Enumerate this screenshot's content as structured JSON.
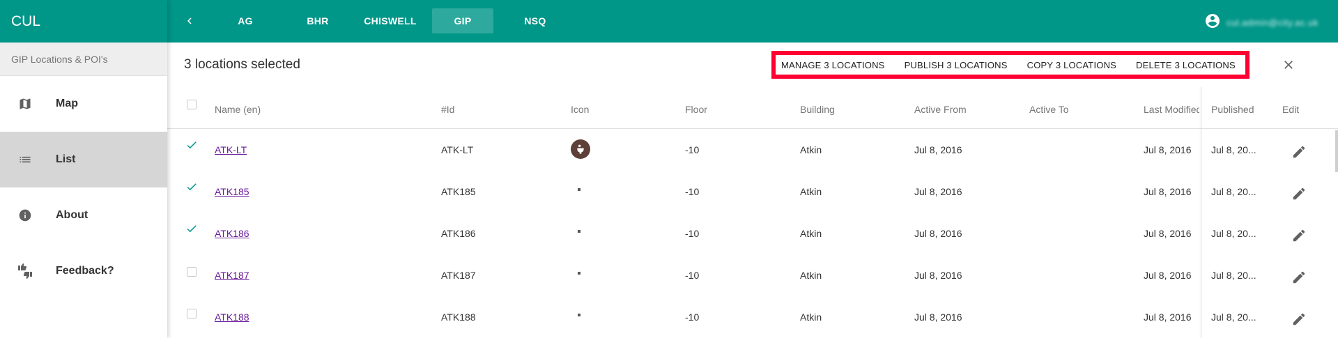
{
  "app": {
    "brand": "CUL"
  },
  "sidebar": {
    "subtitle": "GIP Locations & POI's",
    "items": [
      {
        "label": "Map",
        "icon": "map-icon"
      },
      {
        "label": "List",
        "icon": "list-icon",
        "active": true
      },
      {
        "label": "About",
        "icon": "info-icon"
      },
      {
        "label": "Feedback?",
        "icon": "thumbs-icon"
      }
    ]
  },
  "topbar": {
    "tabs": [
      "AG",
      "BHR",
      "CHISWELL",
      "GIP",
      "NSQ"
    ],
    "active_tab": "GIP",
    "user_email": "cul.admin@city.ac.uk"
  },
  "selection": {
    "count_label": "3 locations selected",
    "actions": {
      "manage": "MANAGE 3 LOCATIONS",
      "publish": "PUBLISH 3 LOCATIONS",
      "copy": "COPY 3 LOCATIONS",
      "delete": "DELETE 3 LOCATIONS"
    }
  },
  "table": {
    "headers": {
      "name": "Name (en)",
      "id": "#Id",
      "icon": "Icon",
      "floor": "Floor",
      "building": "Building",
      "active_from": "Active From",
      "active_to": "Active To",
      "last_modified": "Last Modified",
      "published": "Published",
      "edit": "Edit"
    },
    "rows": [
      {
        "selected": true,
        "name": "ATK-LT",
        "id": "ATK-LT",
        "icon": "toilet-icon",
        "floor": "-10",
        "building": "Atkin",
        "active_from": "Jul 8, 2016",
        "active_to": "",
        "last_modified": "Jul 8, 2016",
        "published": "Jul 8, 20..."
      },
      {
        "selected": true,
        "name": "ATK185",
        "id": "ATK185",
        "icon": "dot-icon",
        "floor": "-10",
        "building": "Atkin",
        "active_from": "Jul 8, 2016",
        "active_to": "",
        "last_modified": "Jul 8, 2016",
        "published": "Jul 8, 20..."
      },
      {
        "selected": true,
        "name": "ATK186",
        "id": "ATK186",
        "icon": "dot-icon",
        "floor": "-10",
        "building": "Atkin",
        "active_from": "Jul 8, 2016",
        "active_to": "",
        "last_modified": "Jul 8, 2016",
        "published": "Jul 8, 20..."
      },
      {
        "selected": false,
        "name": "ATK187",
        "id": "ATK187",
        "icon": "dot-icon",
        "floor": "-10",
        "building": "Atkin",
        "active_from": "Jul 8, 2016",
        "active_to": "",
        "last_modified": "Jul 8, 2016",
        "published": "Jul 8, 20..."
      },
      {
        "selected": false,
        "name": "ATK188",
        "id": "ATK188",
        "icon": "dot-icon",
        "floor": "-10",
        "building": "Atkin",
        "active_from": "Jul 8, 2016",
        "active_to": "",
        "last_modified": "Jul 8, 2016",
        "published": "Jul 8, 20..."
      }
    ]
  },
  "colors": {
    "primary": "#009688",
    "highlight_border": "#ff0033",
    "link": "#6a1b9a"
  }
}
